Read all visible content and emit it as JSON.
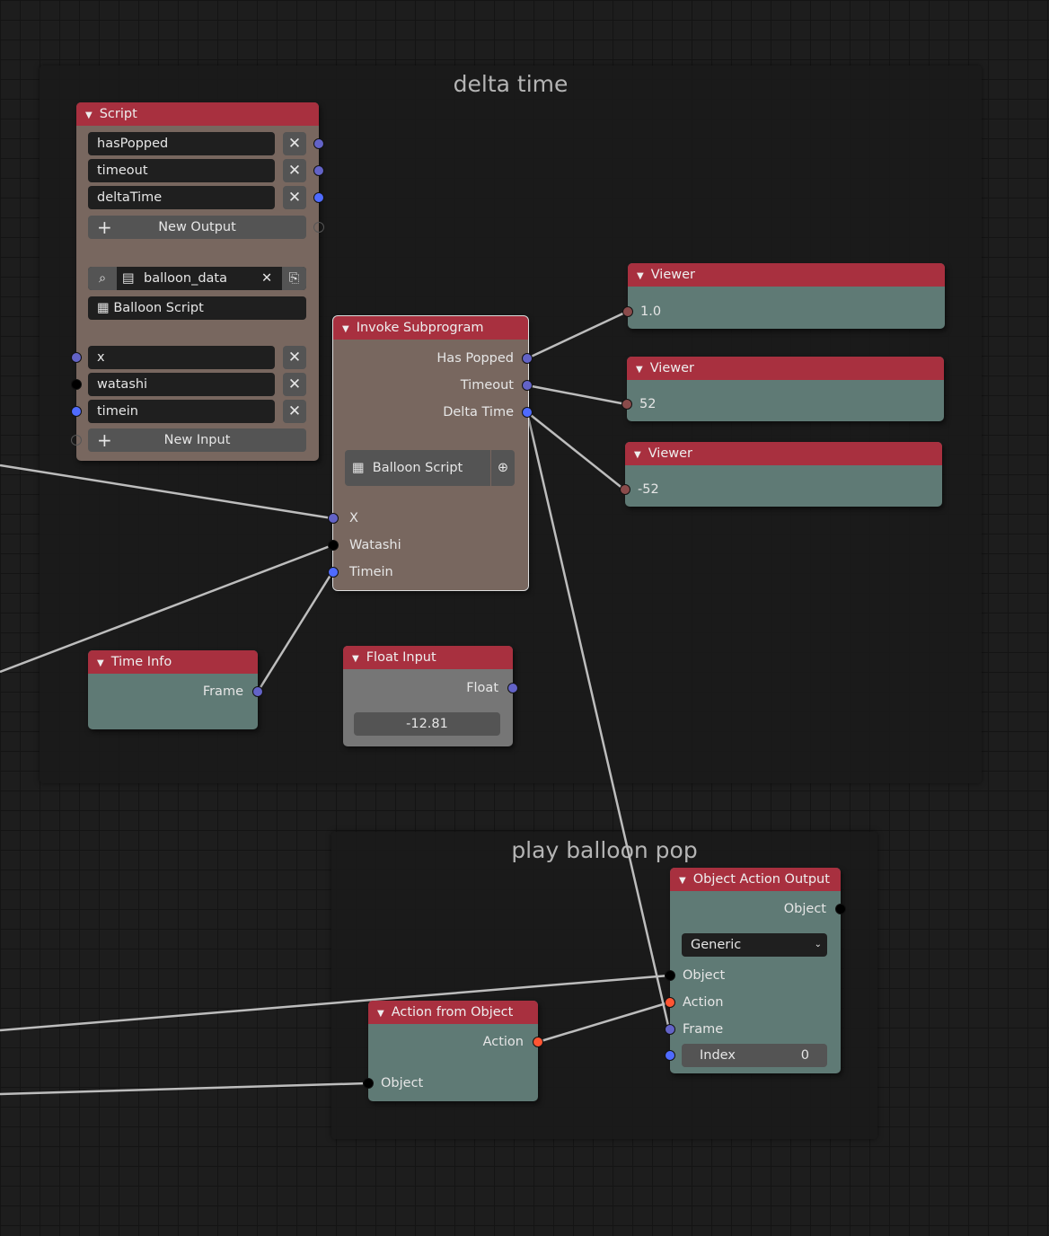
{
  "colors": {
    "header": "#a8303f",
    "socket_float": "#6363c7",
    "socket_blue": "#4f6bff",
    "socket_object": "#000000",
    "socket_action": "#ff5533",
    "socket_generic": "#8a4b4b"
  },
  "frames": {
    "delta_time": "delta time",
    "play_balloon_pop": "play balloon pop"
  },
  "script": {
    "title": "Script",
    "outputs": [
      "hasPopped",
      "timeout",
      "deltaTime"
    ],
    "new_output": "New Output",
    "text_block": "balloon_data",
    "subprogram": "Balloon Script",
    "inputs": [
      "x",
      "watashi",
      "timein"
    ],
    "new_input": "New Input"
  },
  "invoke": {
    "title": "Invoke Subprogram",
    "outputs": [
      "Has Popped",
      "Timeout",
      "Delta Time"
    ],
    "subprogram": "Balloon Script",
    "inputs": [
      "X",
      "Watashi",
      "Timein"
    ]
  },
  "viewers": [
    {
      "title": "Viewer",
      "value": "1.0"
    },
    {
      "title": "Viewer",
      "value": "52"
    },
    {
      "title": "Viewer",
      "value": "-52"
    }
  ],
  "time_info": {
    "title": "Time Info",
    "output": "Frame"
  },
  "float_input": {
    "title": "Float Input",
    "output": "Float",
    "value": "-12.81"
  },
  "object_action_output": {
    "title": "Object Action Output",
    "output": "Object",
    "mode": "Generic",
    "inputs": [
      "Object",
      "Action",
      "Frame"
    ],
    "index_label": "Index",
    "index_value": "0"
  },
  "action_from_object": {
    "title": "Action from Object",
    "output": "Action",
    "input": "Object"
  }
}
